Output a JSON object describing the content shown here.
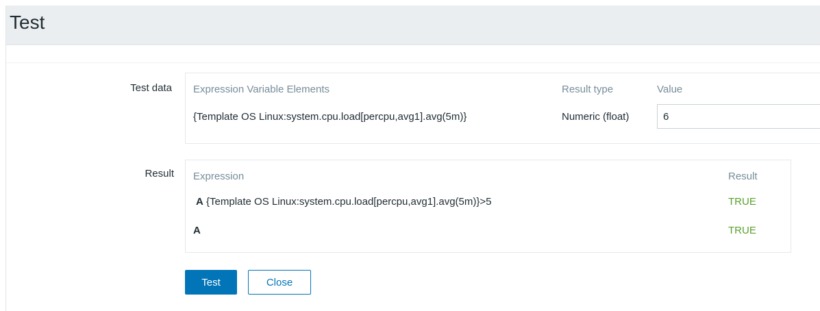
{
  "dialog": {
    "title": "Test"
  },
  "test_data": {
    "label": "Test data",
    "columns": {
      "expression_variable_elements": "Expression Variable Elements",
      "result_type": "Result type",
      "value": "Value"
    },
    "rows": [
      {
        "element": "{Template OS Linux:system.cpu.load[percpu,avg1].avg(5m)}",
        "result_type": "Numeric (float)",
        "value": "6"
      }
    ]
  },
  "result": {
    "label": "Result",
    "columns": {
      "expression": "Expression",
      "result": "Result"
    },
    "rows": [
      {
        "name": "A",
        "expression": "{Template OS Linux:system.cpu.load[percpu,avg1].avg(5m)}>5",
        "result": "TRUE"
      },
      {
        "name": "A",
        "expression": "",
        "result": "TRUE"
      }
    ]
  },
  "buttons": {
    "test": "Test",
    "close": "Close"
  },
  "colors": {
    "primary": "#0275b8",
    "true": "#59a02c",
    "header_bg": "#ebeef0",
    "muted_text": "#768d99"
  }
}
